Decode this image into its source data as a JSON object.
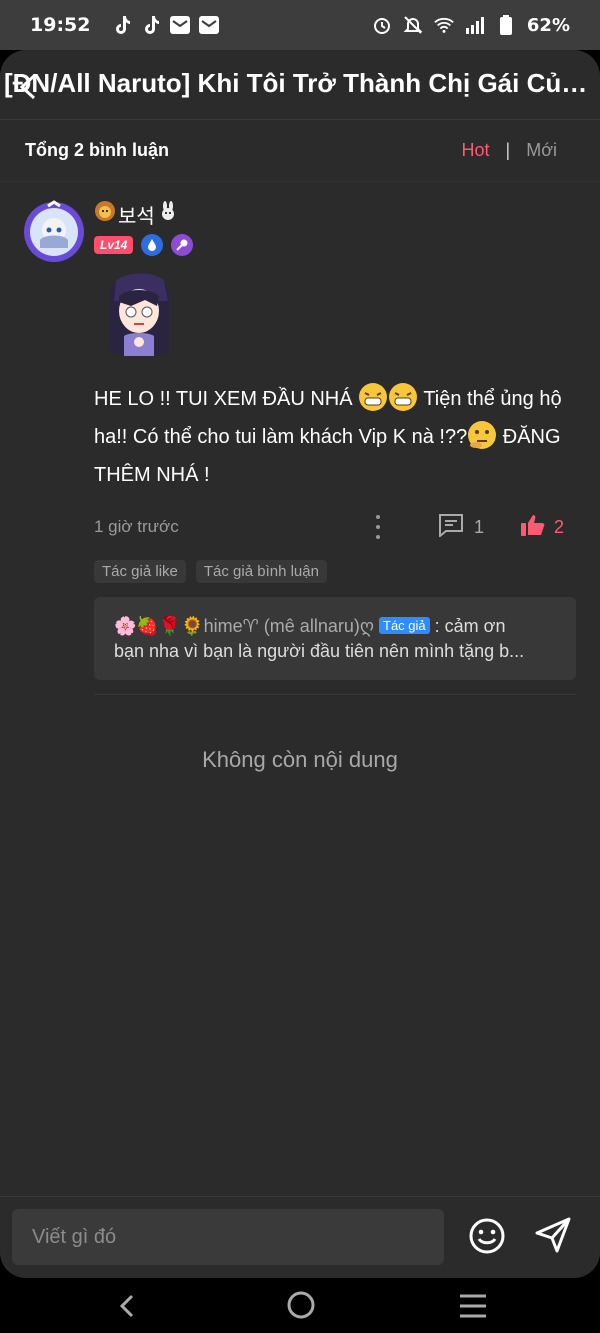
{
  "status_bar": {
    "time": "19:52",
    "battery": "62%"
  },
  "header": {
    "title": "[ĐN/All Naruto] Khi Tôi Trở Thành Chị Gái Của Naruto"
  },
  "comments_header": {
    "total_label": "Tổng 2 bình luận",
    "sort_hot": "Hot",
    "sort_separator": "|",
    "sort_new": "Mới"
  },
  "comment": {
    "username": "보석",
    "level": "Lv14",
    "text_part1": "HE LO !! TUI XEM ĐẦU NHÁ ",
    "text_part2": " Tiện thể ủng hộ ha!! Có thể cho tui làm khách Vip K nà !??",
    "text_part3": " ĐĂNG THÊM NHÁ !",
    "time": "1 giờ trước",
    "reply_count": "1",
    "like_count": "2",
    "tags": [
      "Tác giả like",
      "Tác giả bình luận"
    ],
    "reply": {
      "author": "hime♈ (mê allnaru)ღ",
      "author_badge": "Tác giả",
      "text_line1": " : cảm ơn",
      "text_line2": "bạn nha vì bạn là người đầu tiên nên mình tặng b..."
    }
  },
  "no_more": "Không còn nội dung",
  "input": {
    "placeholder": "Viết gì đó"
  },
  "colors": {
    "accent": "#ff5a72",
    "background": "#2b2b2b"
  }
}
